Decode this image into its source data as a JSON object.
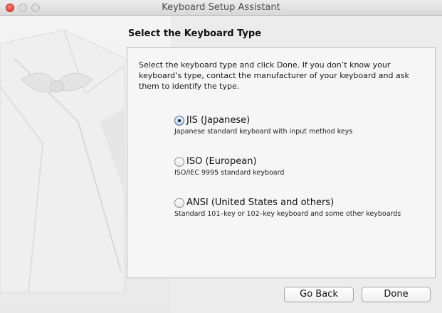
{
  "window": {
    "title": "Keyboard Setup Assistant"
  },
  "content": {
    "heading": "Select the Keyboard Type",
    "intro": "Select the keyboard type and click Done. If you don’t know your keyboard’s type, contact the manufacturer of your keyboard and ask them to identify the type."
  },
  "options": [
    {
      "label": "JIS (Japanese)",
      "description": "Japanese standard keyboard with input method keys",
      "selected": true
    },
    {
      "label": "ISO (European)",
      "description": "ISO/IEC 9995 standard keyboard",
      "selected": false
    },
    {
      "label": "ANSI (United States and others)",
      "description": "Standard 101–key or 102–key keyboard and some other keyboards",
      "selected": false
    }
  ],
  "buttons": {
    "back": "Go Back",
    "done": "Done"
  }
}
